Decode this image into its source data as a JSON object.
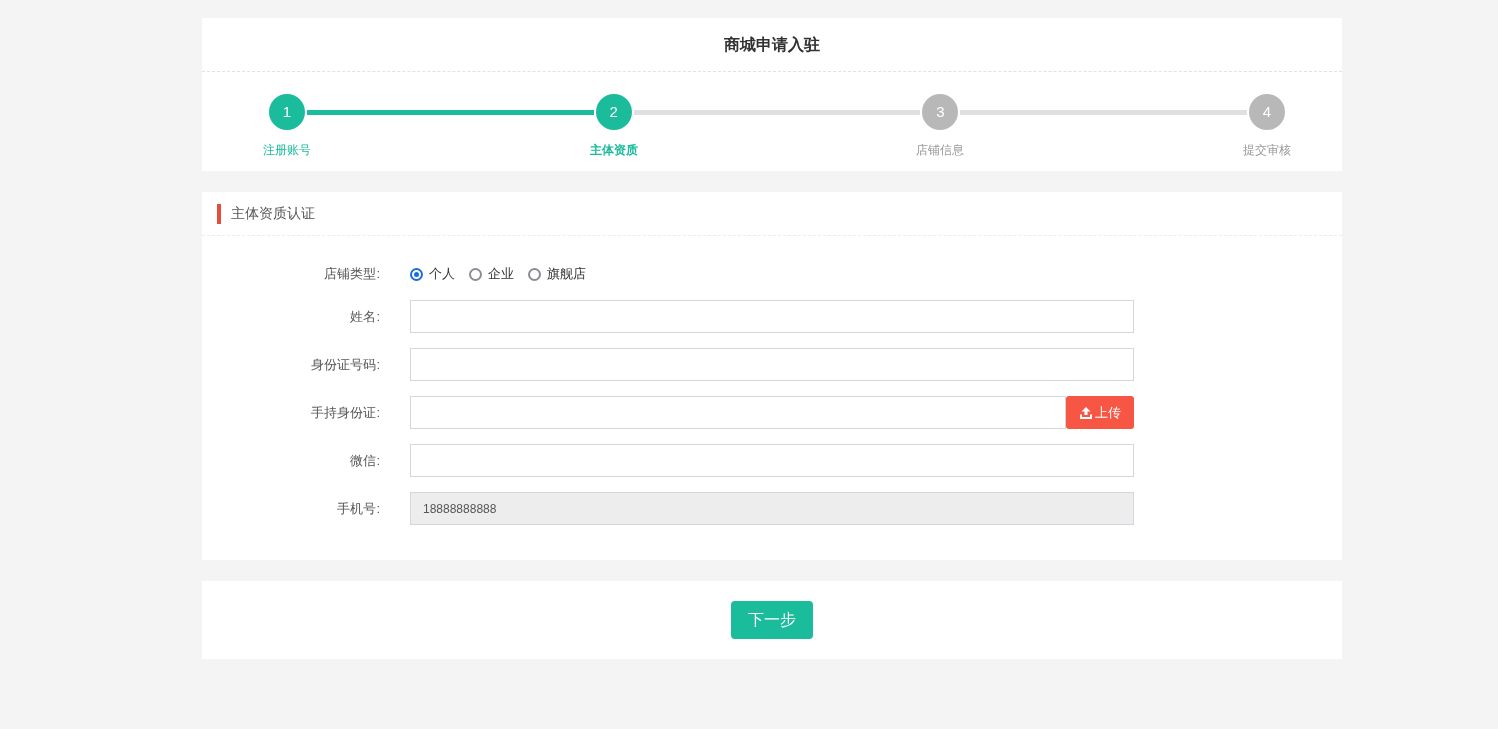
{
  "page_title": "商城申请入驻",
  "steps": [
    {
      "number": "1",
      "label": "注册账号",
      "reached": true,
      "current": false
    },
    {
      "number": "2",
      "label": "主体资质",
      "reached": true,
      "current": true
    },
    {
      "number": "3",
      "label": "店铺信息",
      "reached": false,
      "current": false
    },
    {
      "number": "4",
      "label": "提交审核",
      "reached": false,
      "current": false
    }
  ],
  "section": {
    "title": "主体资质认证",
    "fields": [
      {
        "kind": "radio",
        "label": "店铺类型:",
        "disabled": false,
        "options": [
          {
            "label": "个人",
            "selected": true
          },
          {
            "label": "企业",
            "selected": false
          },
          {
            "label": "旗舰店",
            "selected": false
          }
        ]
      },
      {
        "kind": "text",
        "label": "姓名:",
        "disabled": false
      },
      {
        "kind": "text",
        "label": "身份证号码:",
        "disabled": false
      },
      {
        "kind": "upload",
        "label": "手持身份证:",
        "disabled": false,
        "button": "上传"
      },
      {
        "kind": "text",
        "label": "微信:",
        "disabled": false
      },
      {
        "kind": "text",
        "label": "手机号:",
        "disabled": true,
        "value": "18888888888"
      }
    ]
  },
  "next_button": "下一步"
}
